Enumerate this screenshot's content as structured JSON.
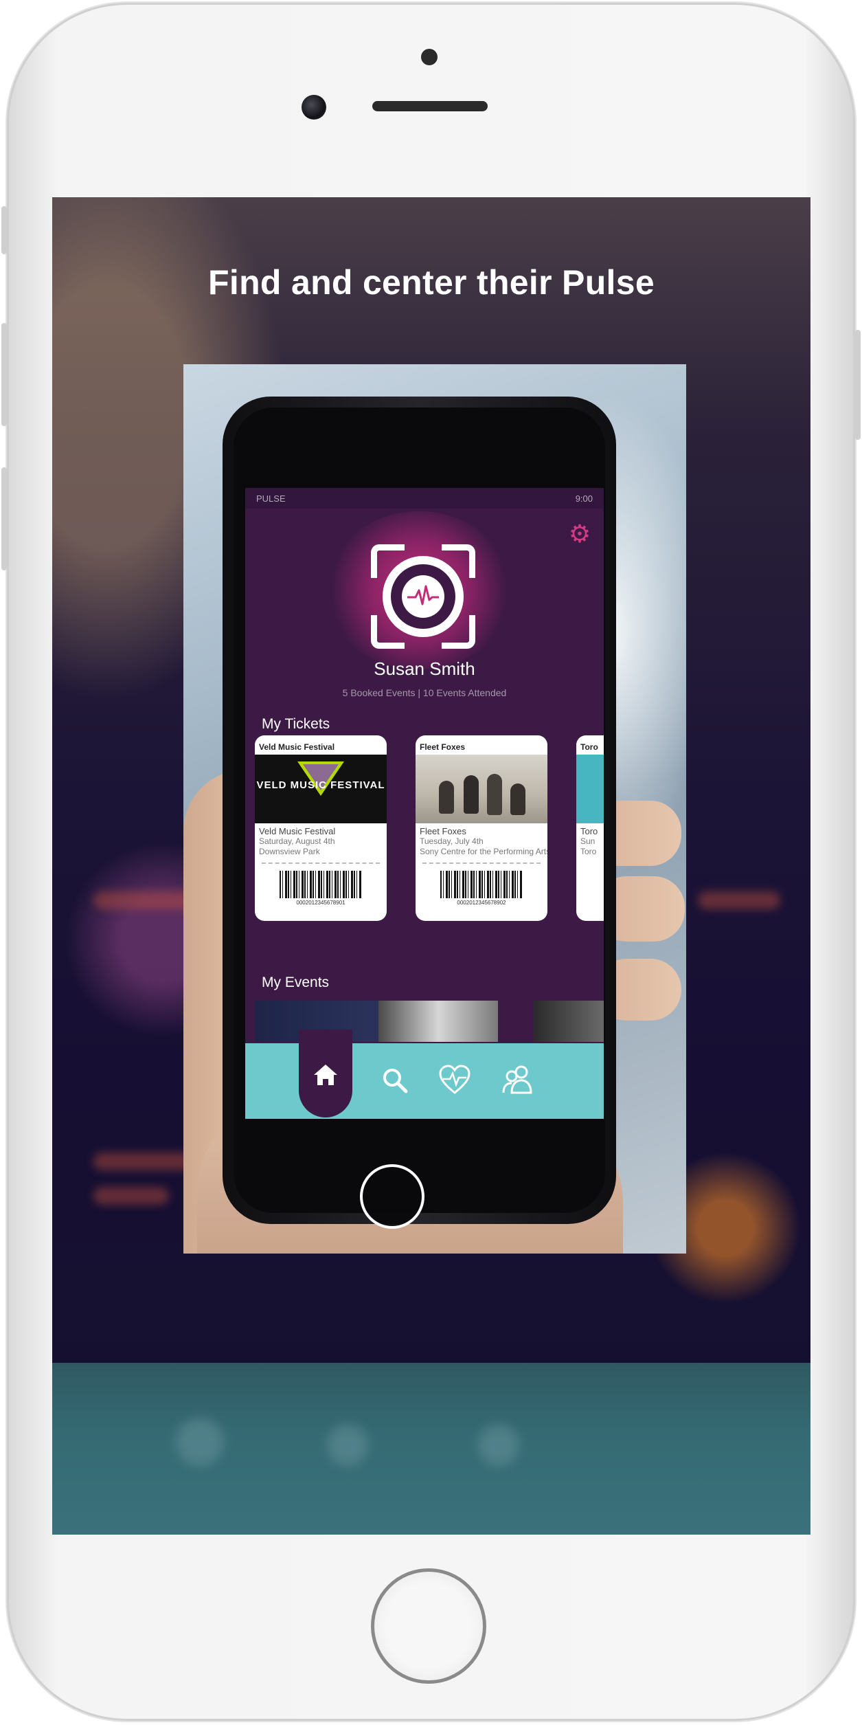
{
  "headline": "Find and center their Pulse",
  "app": {
    "status_bar": {
      "carrier": "PULSE",
      "time": "9:00"
    },
    "profile": {
      "name": "Susan Smith",
      "stats": "5 Booked Events  |  10 Events Attended"
    },
    "sections": {
      "tickets_title": "My Tickets",
      "events_title": "My Events"
    },
    "tickets": [
      {
        "header": "Veld Music Festival",
        "banner": "VELD MUSIC FESTIVAL",
        "title": "Veld Music Festival",
        "date": "Saturday, August 4th",
        "venue": "Downsview Park",
        "barcode_number": "0002012345678901"
      },
      {
        "header": "Fleet Foxes",
        "title": "Fleet Foxes",
        "date": "Tuesday, July 4th",
        "venue": "Sony Centre for the Performing Arts",
        "barcode_number": "0002012345678902"
      },
      {
        "header": "Toro",
        "title": "Toro",
        "date": "Sun",
        "venue": "Toro"
      }
    ],
    "nav": {
      "home_icon": "home-icon",
      "search_icon": "search-icon",
      "pulse_icon": "heart-pulse-icon",
      "friends_icon": "friends-icon"
    }
  },
  "colors": {
    "app_purple": "#3d1a45",
    "accent_pink": "#d43b83",
    "nav_teal": "#6ec9cc"
  }
}
